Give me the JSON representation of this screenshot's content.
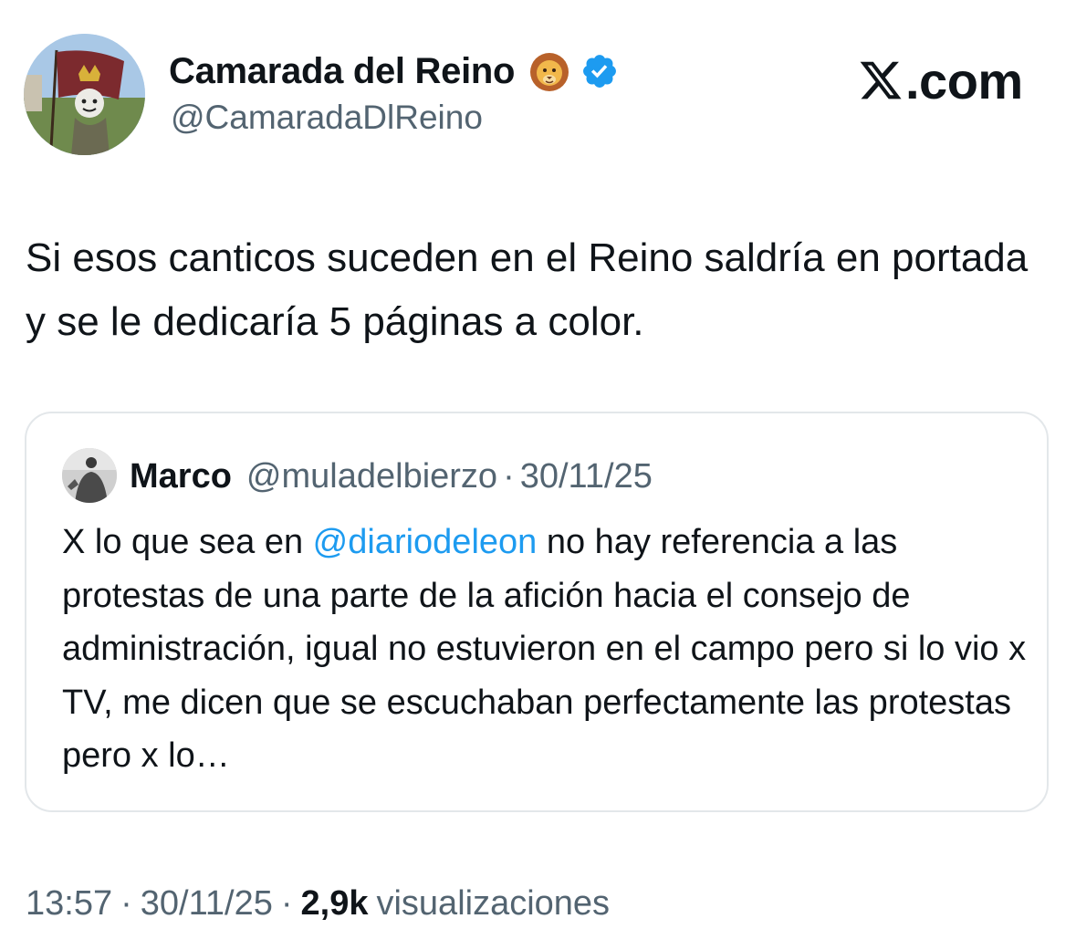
{
  "author": {
    "display_name": "Camarada del Reino",
    "name_emoji": "lion-face-icon",
    "verified_icon": "verified-badge-icon",
    "handle": "@CamaradaDlReino"
  },
  "brand": {
    "icon": "x-logo-icon",
    "text": ".com"
  },
  "tweet": {
    "text": "Si esos canticos suceden en el Reino saldría en portada y se le dedicaría 5 páginas a color."
  },
  "quoted_tweet": {
    "name": "Marco",
    "handle": "@muladelbierzo",
    "separator": "·",
    "date": "30/11/25",
    "text_before_mention": "X lo que sea en ",
    "mention": "@diariodeleon",
    "text_after_mention": " no hay referencia a las protestas de una parte de la afición hacia el consejo de administración, igual no estuvieron en el campo pero si lo vio x TV, me dicen que se escuchaban perfectamente las protestas pero x lo…"
  },
  "meta": {
    "time": "13:57",
    "separator": "·",
    "date": "30/11/25",
    "views_count": "2,9k",
    "views_label": "visualizaciones"
  },
  "colors": {
    "text": "#0f1419",
    "secondary": "#536471",
    "link": "#1d9bf0",
    "verified": "#1d9bf0",
    "card_border": "#e3e7ea"
  }
}
